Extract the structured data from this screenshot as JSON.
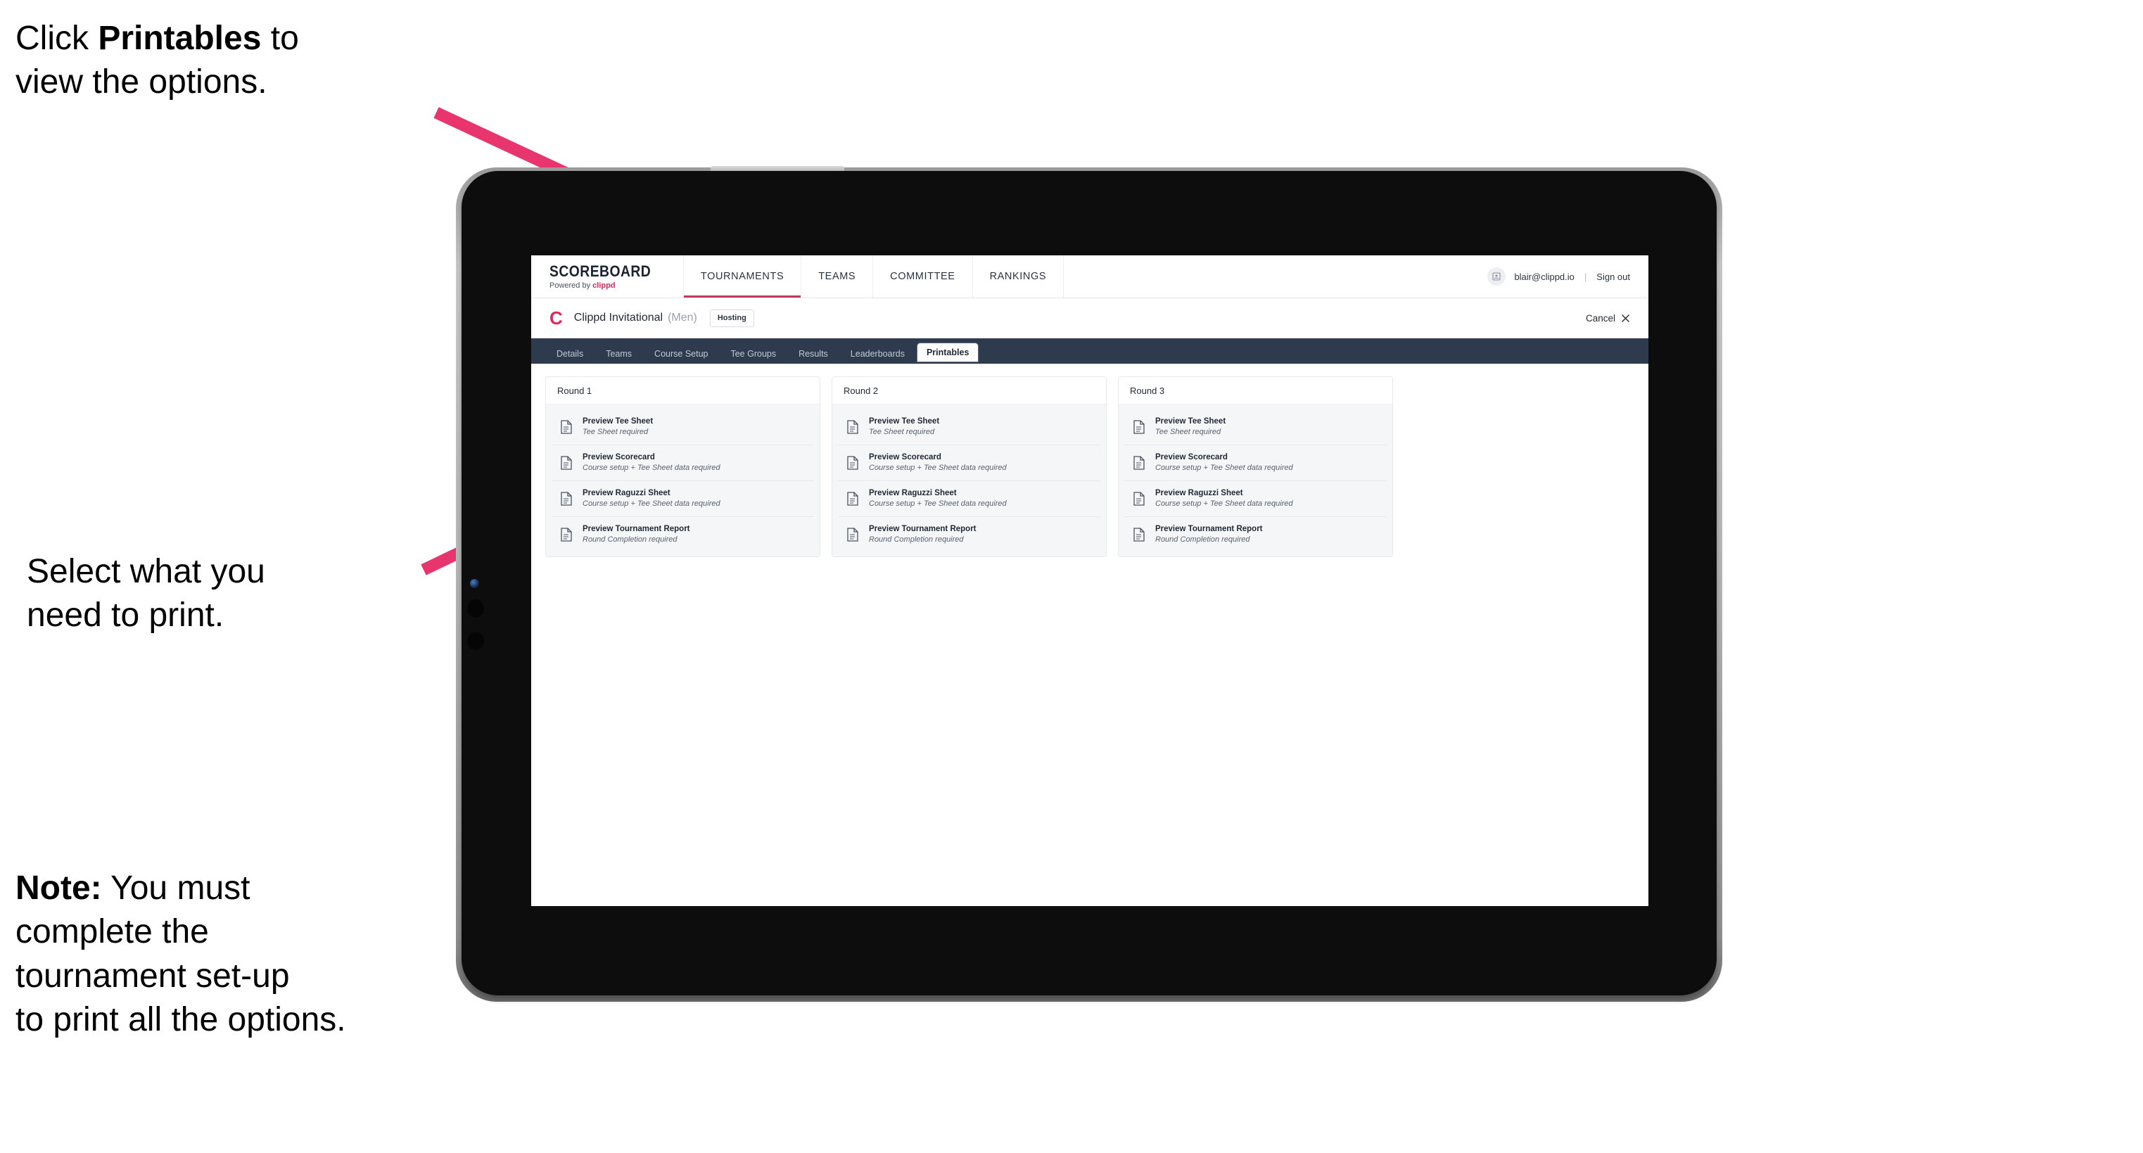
{
  "annotations": {
    "top": {
      "pre": "Click ",
      "bold": "Printables",
      "post": " to\nview the options."
    },
    "middle": {
      "text": "Select what you\n need to print."
    },
    "note": {
      "bold": "Note:",
      "text": " You must\ncomplete the\ntournament set-up\nto print all the options."
    }
  },
  "colors": {
    "arrow_pink": "#E8356D",
    "tabbar_navy": "#2E3A4E",
    "brand_crimson": "#E1275C",
    "nav_active_underline": "#C4375E",
    "card_gray": "#F5F6F7"
  },
  "app": {
    "brand": {
      "title": "SCOREBOARD",
      "powered_prefix": "Powered by ",
      "powered_name": "clippd"
    },
    "nav": [
      {
        "label": "TOURNAMENTS",
        "active": true
      },
      {
        "label": "TEAMS",
        "active": false
      },
      {
        "label": "COMMITTEE",
        "active": false
      },
      {
        "label": "RANKINGS",
        "active": false
      }
    ],
    "user": {
      "avatar_icon": "user-avatar-icon",
      "email": "blair@clippd.io",
      "separator": "|",
      "sign_out": "Sign out"
    },
    "tournament_bar": {
      "logo_letter": "C",
      "name": "Clippd Invitational",
      "gender": "(Men)",
      "hosting_badge": "Hosting",
      "cancel_label": "Cancel",
      "cancel_icon": "close-icon"
    },
    "tabs": [
      {
        "label": "Details",
        "active": false
      },
      {
        "label": "Teams",
        "active": false
      },
      {
        "label": "Course Setup",
        "active": false
      },
      {
        "label": "Tee Groups",
        "active": false
      },
      {
        "label": "Results",
        "active": false
      },
      {
        "label": "Leaderboards",
        "active": false
      },
      {
        "label": "Printables",
        "active": true
      }
    ],
    "rounds": [
      {
        "title": "Round 1",
        "items": [
          {
            "title": "Preview Tee Sheet",
            "sub": "Tee Sheet required"
          },
          {
            "title": "Preview Scorecard",
            "sub": "Course setup + Tee Sheet data required"
          },
          {
            "title": "Preview Raguzzi Sheet",
            "sub": "Course setup + Tee Sheet data required"
          },
          {
            "title": "Preview Tournament Report",
            "sub": "Round Completion required"
          }
        ]
      },
      {
        "title": "Round 2",
        "items": [
          {
            "title": "Preview Tee Sheet",
            "sub": "Tee Sheet required"
          },
          {
            "title": "Preview Scorecard",
            "sub": "Course setup + Tee Sheet data required"
          },
          {
            "title": "Preview Raguzzi Sheet",
            "sub": "Course setup + Tee Sheet data required"
          },
          {
            "title": "Preview Tournament Report",
            "sub": "Round Completion required"
          }
        ]
      },
      {
        "title": "Round 3",
        "items": [
          {
            "title": "Preview Tee Sheet",
            "sub": "Tee Sheet required"
          },
          {
            "title": "Preview Scorecard",
            "sub": "Course setup + Tee Sheet data required"
          },
          {
            "title": "Preview Raguzzi Sheet",
            "sub": "Course setup + Tee Sheet data required"
          },
          {
            "title": "Preview Tournament Report",
            "sub": "Round Completion required"
          }
        ]
      }
    ]
  }
}
